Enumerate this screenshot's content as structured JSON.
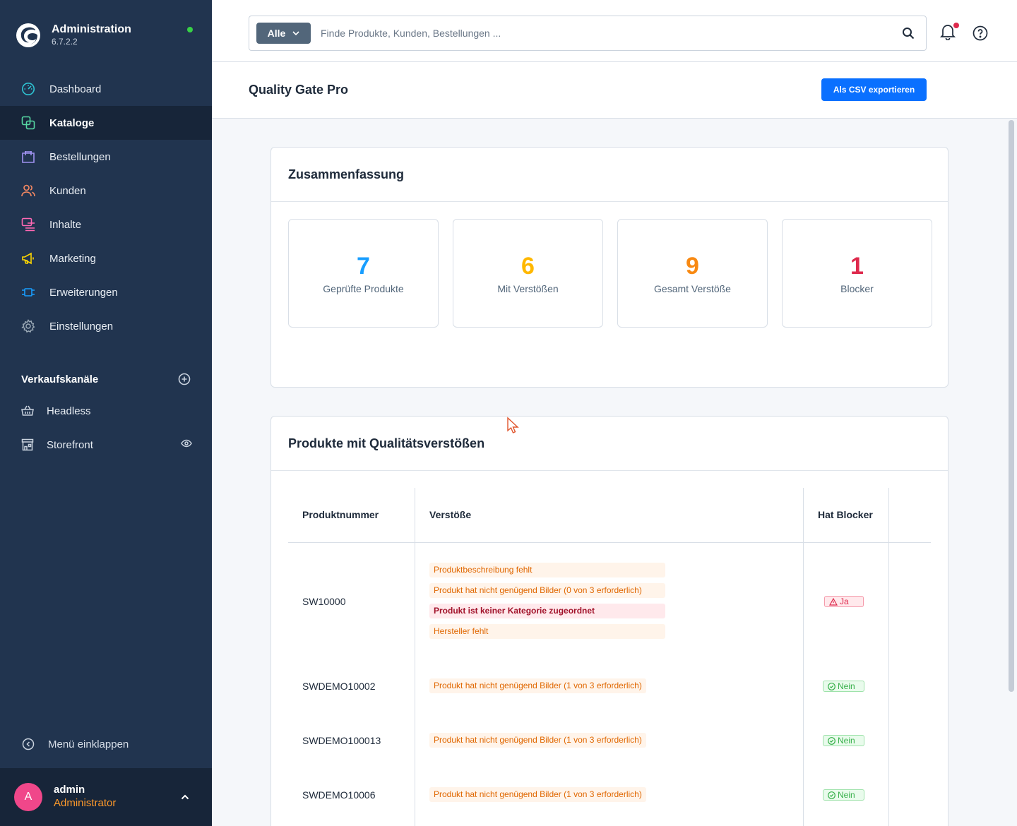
{
  "brand": {
    "title": "Administration",
    "version": "6.7.2.2",
    "status_color": "#37d046"
  },
  "nav": {
    "items": [
      {
        "label": "Dashboard",
        "icon": "gauge-icon",
        "color": "#2ec4d3"
      },
      {
        "label": "Kataloge",
        "icon": "catalog-icon",
        "color": "#57d9a3",
        "active": true
      },
      {
        "label": "Bestellungen",
        "icon": "shopping-bag-icon",
        "color": "#a092f0"
      },
      {
        "label": "Kunden",
        "icon": "users-icon",
        "color": "#f88962"
      },
      {
        "label": "Inhalte",
        "icon": "content-icon",
        "color": "#ff68b4"
      },
      {
        "label": "Marketing",
        "icon": "megaphone-icon",
        "color": "#ffd700"
      },
      {
        "label": "Erweiterungen",
        "icon": "plug-icon",
        "color": "#189eff"
      },
      {
        "label": "Einstellungen",
        "icon": "gear-icon",
        "color": "#9aa8b5"
      }
    ]
  },
  "sales_channels": {
    "heading": "Verkaufskanäle",
    "items": [
      {
        "label": "Headless",
        "icon": "basket-icon"
      },
      {
        "label": "Storefront",
        "icon": "storefront-icon"
      }
    ]
  },
  "collapse_label": "Menü einklappen",
  "user": {
    "initial": "A",
    "name": "admin",
    "role": "Administrator"
  },
  "search": {
    "type_label": "Alle",
    "placeholder": "Finde Produkte, Kunden, Bestellungen ..."
  },
  "page": {
    "title": "Quality Gate Pro",
    "export_label": "Als CSV exportieren"
  },
  "summary": {
    "title": "Zusammenfassung",
    "stats": [
      {
        "value": "7",
        "label": "Geprüfte Produkte",
        "color": "#189eff"
      },
      {
        "value": "6",
        "label": "Mit Verstößen",
        "color": "#ffb800"
      },
      {
        "value": "9",
        "label": "Gesamt Verstöße",
        "color": "#f88912"
      },
      {
        "value": "1",
        "label": "Blocker",
        "color": "#de294c"
      }
    ]
  },
  "products": {
    "title": "Produkte mit Qualitätsverstößen",
    "columns": [
      "Produktnummer",
      "Verstöße",
      "Hat Blocker"
    ],
    "rows": [
      {
        "number": "SW10000",
        "violations": [
          {
            "text": "Produktbeschreibung fehlt",
            "blocker": false
          },
          {
            "text": "Produkt hat nicht genügend Bilder (0 von 3 erforderlich)",
            "blocker": false
          },
          {
            "text": "Produkt ist keiner Kategorie zugeordnet",
            "blocker": true
          },
          {
            "text": "Hersteller fehlt",
            "blocker": false
          }
        ],
        "has_blocker": "Ja"
      },
      {
        "number": "SWDEMO10002",
        "violations": [
          {
            "text": "Produkt hat nicht genügend Bilder (1 von 3 erforderlich)",
            "blocker": false
          }
        ],
        "has_blocker": "Nein"
      },
      {
        "number": "SWDEMO100013",
        "violations": [
          {
            "text": "Produkt hat nicht genügend Bilder (1 von 3 erforderlich)",
            "blocker": false
          }
        ],
        "has_blocker": "Nein"
      },
      {
        "number": "SWDEMO10006",
        "violations": [
          {
            "text": "Produkt hat nicht genügend Bilder (1 von 3 erforderlich)",
            "blocker": false
          }
        ],
        "has_blocker": "Nein"
      }
    ]
  }
}
